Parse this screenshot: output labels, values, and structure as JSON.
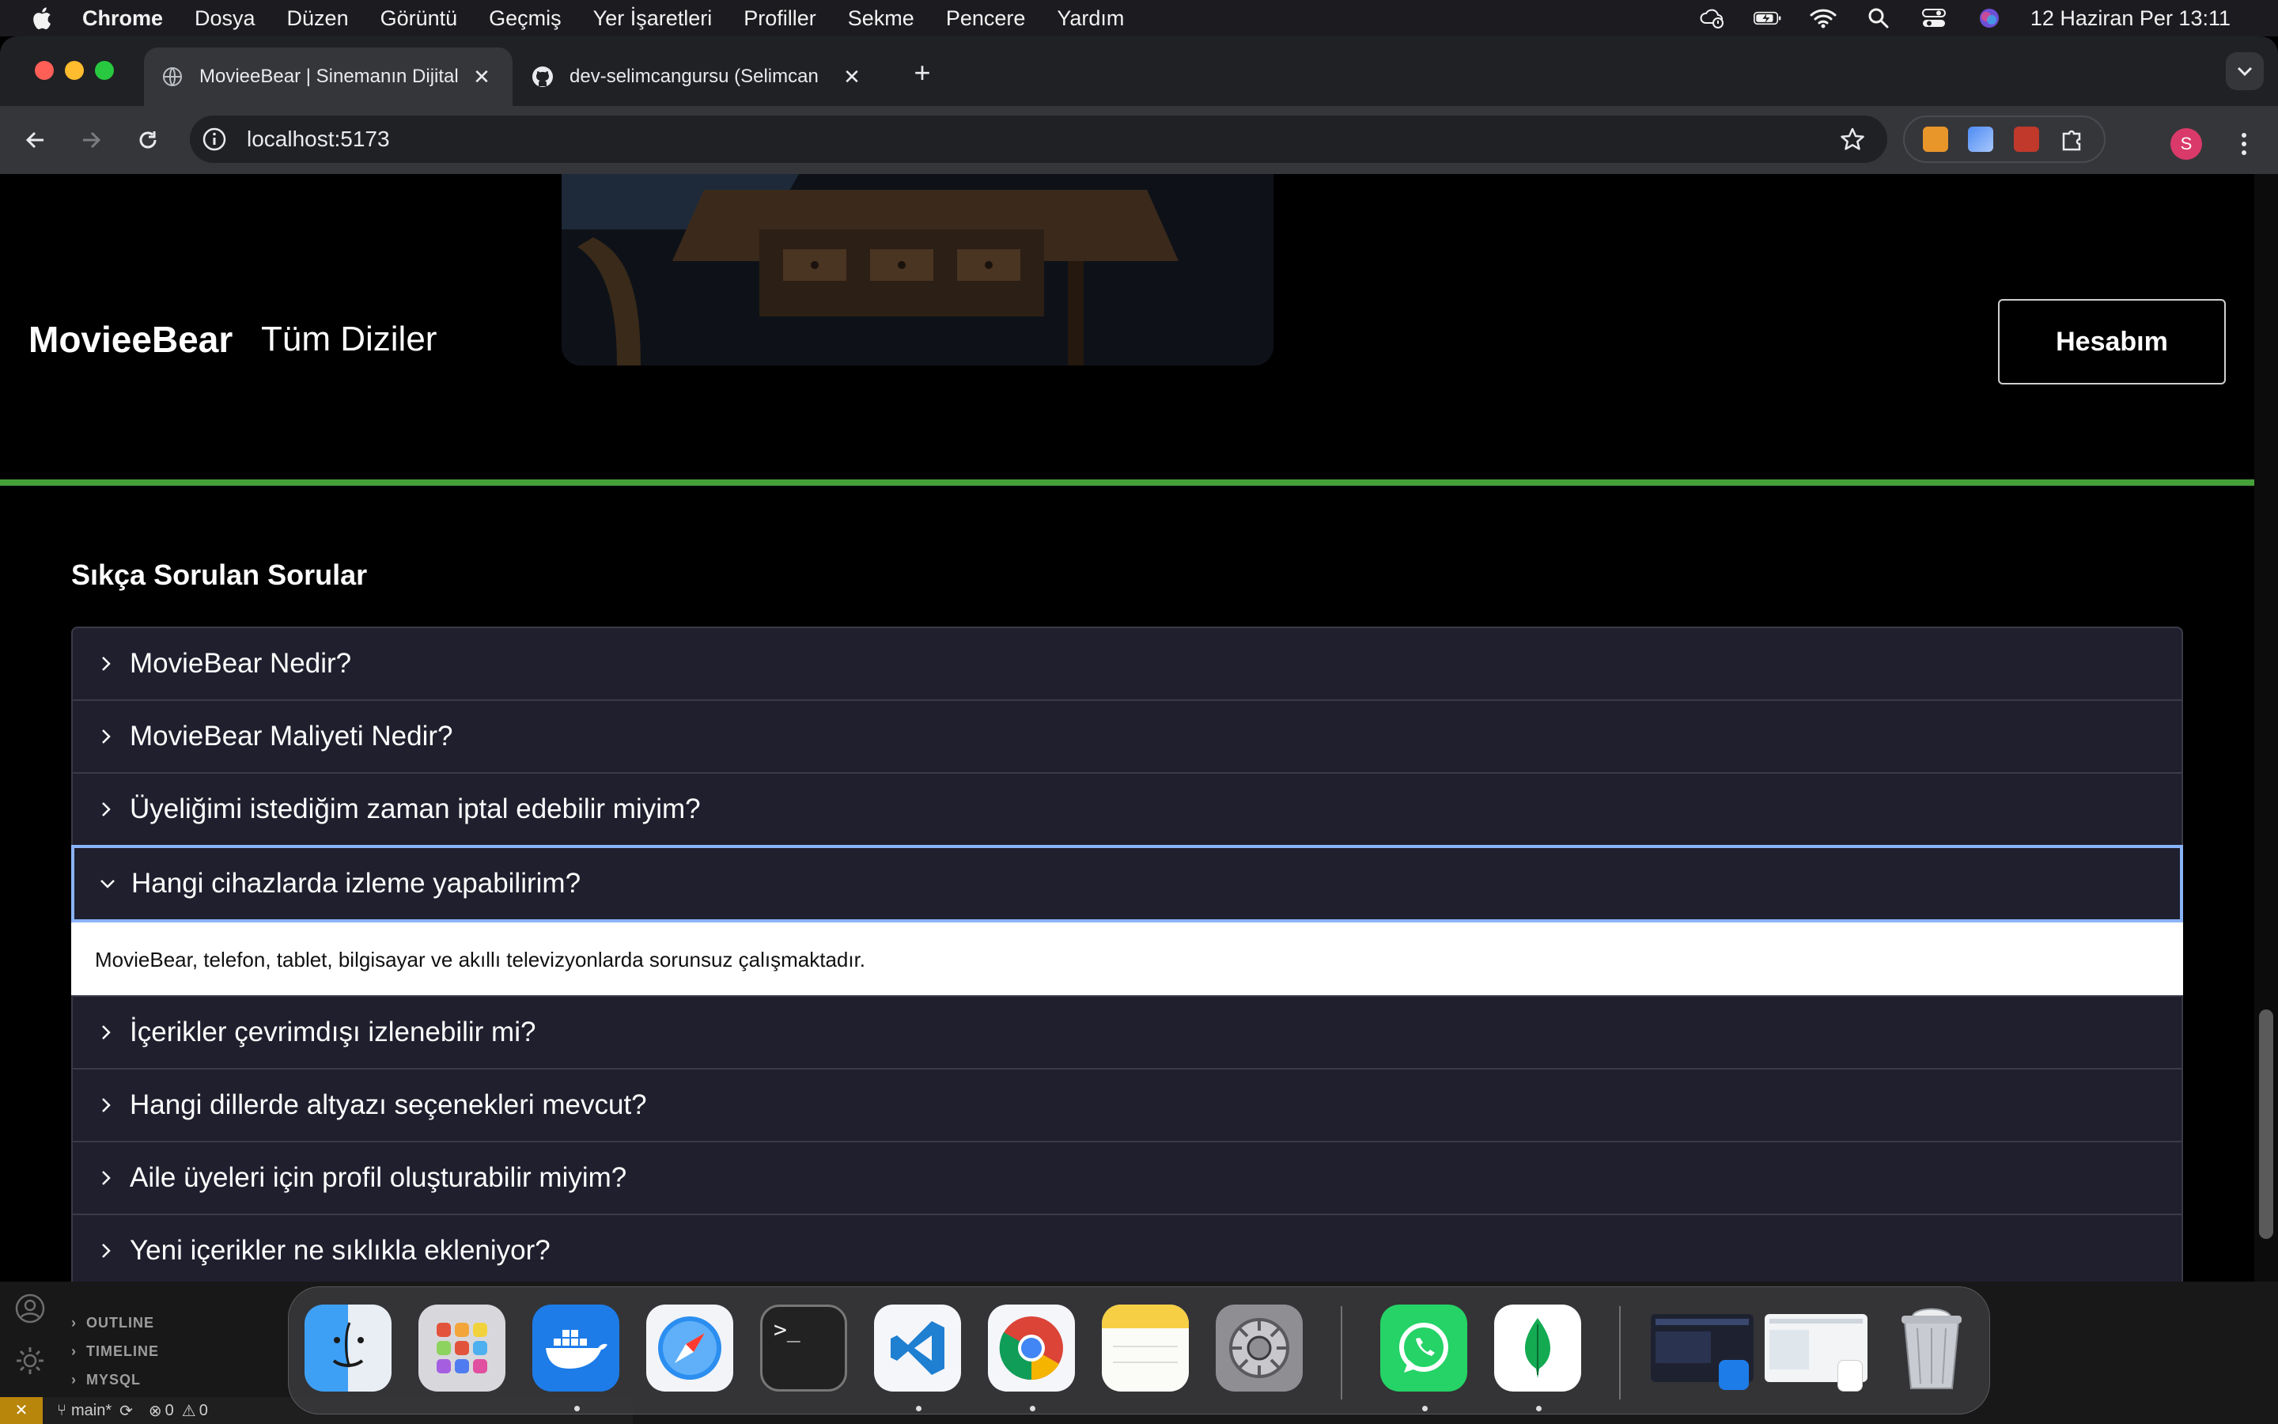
{
  "menubar": {
    "app_name": "Chrome",
    "items": [
      "Dosya",
      "Düzen",
      "Görüntü",
      "Geçmiş",
      "Yer İşaretleri",
      "Profiller",
      "Sekme",
      "Pencere",
      "Yardım"
    ],
    "clock": "12 Haziran Per  13:11"
  },
  "tabs": [
    {
      "title": "MovieeBear | Sinemanın Dijital",
      "active": true
    },
    {
      "title": "dev-selimcangursu (Selimcan",
      "active": false
    }
  ],
  "omnibox": {
    "url": "localhost:5173"
  },
  "profile": {
    "initial": "S"
  },
  "site": {
    "brand": "MovieeBear",
    "nav_link": "Tüm Diziler",
    "account_button": "Hesabım",
    "faq_title": "Sıkça Sorulan Sorular",
    "faq": [
      {
        "question": "MovieBear Nedir?",
        "open": false
      },
      {
        "question": "MovieBear Maliyeti Nedir?",
        "open": false
      },
      {
        "question": "Üyeliğimi istediğim zaman iptal edebilir miyim?",
        "open": false
      },
      {
        "question": "Hangi cihazlarda izleme yapabilirim?",
        "open": true,
        "answer": "MovieBear, telefon, tablet, bilgisayar ve akıllı televizyonlarda sorunsuz çalışmaktadır."
      },
      {
        "question": "İçerikler çevrimdışı izlenebilir mi?",
        "open": false
      },
      {
        "question": "Hangi dillerde altyazı seçenekleri mevcut?",
        "open": false
      },
      {
        "question": "Aile üyeleri için profil oluşturabilir miyim?",
        "open": false
      },
      {
        "question": "Yeni içerikler ne sıklıkla ekleniyor?",
        "open": false
      }
    ]
  },
  "vscode": {
    "panels": [
      "OUTLINE",
      "TIMELINE",
      "MYSQL"
    ],
    "branch": "main*",
    "errors": "0",
    "warnings": "0"
  },
  "dock": {
    "apps": [
      "finder-icon",
      "launchpad-icon",
      "docker-icon",
      "safari-icon",
      "terminal-icon",
      "vscode-icon",
      "chrome-icon",
      "notes-icon",
      "system-settings-icon",
      "whatsapp-icon",
      "mongodb-compass-icon",
      "trash-icon"
    ]
  },
  "colors": {
    "accent_green": "#46a03a",
    "faq_bg": "#1f1f2e",
    "focus_ring": "#8ab4f8"
  }
}
